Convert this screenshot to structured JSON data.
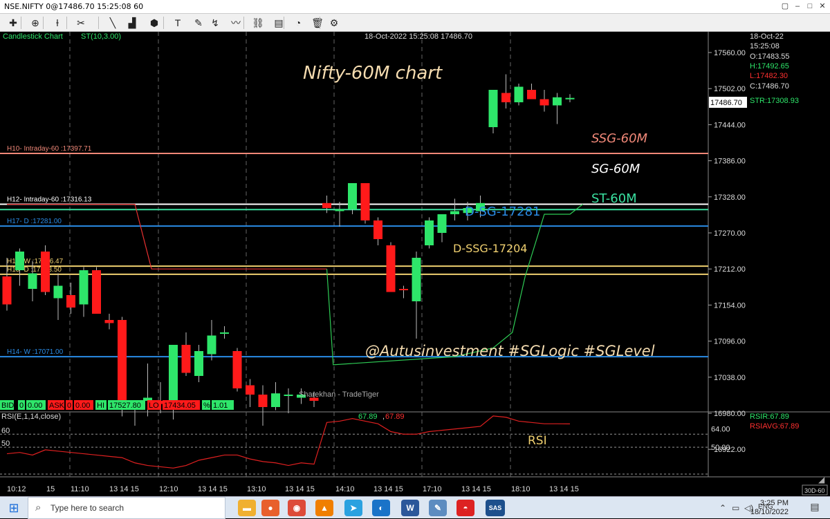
{
  "window": {
    "title": "NSE.NIFTY 0@17486.70 15:25:08 60",
    "buttons": [
      "▢",
      "–",
      "□",
      "✕"
    ]
  },
  "toolbar": {
    "icons": [
      "cursor-icon",
      "crosshair-icon",
      "bar-type-icon",
      "studies-icon",
      "trendline-icon",
      "volume-bars-icon",
      "cube-icon",
      "text-tool-icon",
      "pencil-icon",
      "fibonacci-icon",
      "wave-icon",
      "link-icon",
      "template-icon",
      "analyzer-icon",
      "delete-icon",
      "settings-icon"
    ],
    "glyphs": [
      "✚",
      "⊕",
      "Ɨ",
      "✂",
      "╲",
      "▟",
      "⬢",
      "T",
      "✎",
      "↯",
      "〰",
      "⛓",
      "▤",
      "◔",
      "🗑",
      "⚙"
    ]
  },
  "chart_header": {
    "chart_type": "Candlestick Chart",
    "indicator": "ST(10,3.00)",
    "datetime_price": "18-Oct-2022  15:25:08  17486.70"
  },
  "ohlc_panel": {
    "date": "18-Oct-22",
    "time": "15:25:08",
    "open": "O:17483.55",
    "high": "H:17492.65",
    "low": "L:17482.30",
    "close": "C:17486.70",
    "str": "STR:17308.93",
    "price_tag": "17486.70"
  },
  "quote_bar": {
    "bid_label": "BID",
    "bid_a": "0",
    "bid_b": "0.00",
    "ask_label": "ASK",
    "ask_a": "0",
    "ask_b": "0.00",
    "hi_label": "HI",
    "hi": "17527.80",
    "lo_label": "LO",
    "lo": "17434.05",
    "pct_label": "%",
    "pct": "1.01"
  },
  "annotations": {
    "title": "Nifty-60M chart",
    "ssg": "SSG-60M",
    "sg": "SG-60M",
    "st": "ST-60M",
    "dsg": "D-SG-17281",
    "dssg": "D-SSG-17204",
    "handle": "@Autusinvestment   #SGLogic   #SGLevel",
    "watermark": "Sharekhan - TradeTiger",
    "rsi": "RSI"
  },
  "levels": [
    {
      "label": "H10- Intraday-60 :17397.71",
      "price": 17397.71,
      "color": "#f08878"
    },
    {
      "label": "H12- Intraday-60 :17316.13",
      "price": 17316.13,
      "color": "#ffffff"
    },
    {
      "label": "",
      "price": 17307.5,
      "color": "#3ae0a0"
    },
    {
      "label": "H17- D :17281.00",
      "price": 17281.0,
      "color": "#2a8ce6"
    },
    {
      "label": "H15- W :17216.47",
      "price": 17216.47,
      "color": "#f0d070"
    },
    {
      "label": "H13- D :17203.50",
      "price": 17203.5,
      "color": "#f0d070"
    },
    {
      "label": "H14- W :17071.00",
      "price": 17071.0,
      "color": "#2a8ce6"
    }
  ],
  "rsi_panel": {
    "label": "RSI(E,1,14,close)",
    "value": "67.89",
    "avg": "67.89",
    "rsir": "RSIR:67.89",
    "rsiavg": "RSIAVG:67.89",
    "left_ticks": [
      "60",
      "50"
    ],
    "right_ticks": [
      "64.00",
      "50.00"
    ]
  },
  "colors": {
    "up": "#2ee66a",
    "down": "#ff1a1a",
    "st": "#2ecc55",
    "resistance_st": "#e83030"
  },
  "chart_data": {
    "type": "candlestick",
    "y_ticks": [
      17560,
      17502,
      17444,
      17386,
      17328,
      17270,
      17212,
      17154,
      17096,
      17038,
      16980,
      16922
    ],
    "y_tick_labels": [
      "17560.00",
      "17502.00",
      "17444.00",
      "17386.00",
      "17328.00",
      "17270.00",
      "17212.00",
      "17154.00",
      "17096.00",
      "17038.00",
      "16980.00",
      "16922.00"
    ],
    "x_labels": [
      "10:12",
      "15",
      "11:10",
      "13 14 15",
      "12:10",
      "13 14 15",
      "13:10",
      "13 14 15",
      "14:10",
      "13 14 15",
      "17:10",
      "13 14 15",
      "18:10",
      "13 14 15"
    ],
    "ohlc": [
      [
        17200,
        17230,
        17145,
        17155
      ],
      [
        17210,
        17245,
        17185,
        17240
      ],
      [
        17180,
        17225,
        17160,
        17205
      ],
      [
        17240,
        17250,
        17170,
        17175
      ],
      [
        17165,
        17205,
        17130,
        17185
      ],
      [
        17170,
        17190,
        17140,
        17150
      ],
      [
        17155,
        17215,
        17135,
        17210
      ],
      [
        17210,
        17215,
        17155,
        17140
      ],
      [
        17130,
        17140,
        17115,
        17125
      ],
      [
        17130,
        17135,
        16975,
        16990
      ],
      [
        16995,
        16998,
        16960,
        16995
      ],
      [
        17000,
        17060,
        16975,
        17005
      ],
      [
        17000,
        17030,
        16980,
        16995
      ],
      [
        16995,
        17085,
        16970,
        17090
      ],
      [
        17090,
        17110,
        17040,
        17045
      ],
      [
        17040,
        17090,
        17030,
        17080
      ],
      [
        17075,
        17130,
        17065,
        17105
      ],
      [
        17110,
        17120,
        17100,
        17110
      ],
      [
        17080,
        17085,
        17015,
        17020
      ],
      [
        17025,
        17035,
        16990,
        17010
      ],
      [
        17010,
        17025,
        16960,
        16990
      ],
      [
        16990,
        17030,
        16985,
        17012
      ],
      [
        17010,
        17020,
        16980,
        17010
      ],
      [
        17005,
        17020,
        16995,
        17010
      ],
      [
        17005,
        17015,
        16990,
        17000
      ],
      [
        17318,
        17330,
        17302,
        17310
      ],
      [
        17305,
        17320,
        17280,
        17308
      ],
      [
        17308,
        17350,
        17300,
        17350
      ],
      [
        17350,
        17350,
        17285,
        17290
      ],
      [
        17290,
        17295,
        17250,
        17260
      ],
      [
        17250,
        17255,
        17180,
        17175
      ],
      [
        17180,
        17185,
        17165,
        17178
      ],
      [
        17160,
        17240,
        17100,
        17230
      ],
      [
        17250,
        17295,
        17245,
        17290
      ],
      [
        17270,
        17280,
        17255,
        17300
      ],
      [
        17300,
        17325,
        17290,
        17305
      ],
      [
        17302,
        17320,
        17290,
        17310
      ],
      [
        17305,
        17330,
        17295,
        17318
      ],
      [
        17440,
        17500,
        17430,
        17500
      ],
      [
        17495,
        17525,
        17470,
        17480
      ],
      [
        17480,
        17510,
        17475,
        17505
      ],
      [
        17500,
        17510,
        17490,
        17485
      ],
      [
        17485,
        17500,
        17465,
        17475
      ],
      [
        17475,
        17495,
        17445,
        17488
      ],
      [
        17485,
        17493,
        17480,
        17487
      ]
    ],
    "st_resistance": [
      [
        0,
        17316
      ],
      [
        10,
        17316
      ],
      [
        11,
        17212
      ],
      [
        20,
        17212
      ],
      [
        25,
        17212
      ]
    ],
    "st_support": [
      [
        25,
        17060
      ],
      [
        35,
        17071
      ],
      [
        38,
        17100
      ],
      [
        40,
        17150
      ],
      [
        41,
        17210
      ],
      [
        42,
        17280
      ],
      [
        45,
        17308.93
      ]
    ],
    "rsi_values": [
      45,
      46,
      44,
      48,
      47,
      46,
      45,
      44,
      43,
      42,
      38,
      36,
      35,
      34,
      36,
      40,
      42,
      44,
      44,
      41,
      39,
      38,
      36,
      38,
      37,
      69,
      70,
      72,
      70,
      68,
      62,
      60,
      60,
      62,
      63,
      64,
      65,
      66,
      74,
      73,
      70,
      69,
      68,
      68,
      67.89
    ]
  }
}
